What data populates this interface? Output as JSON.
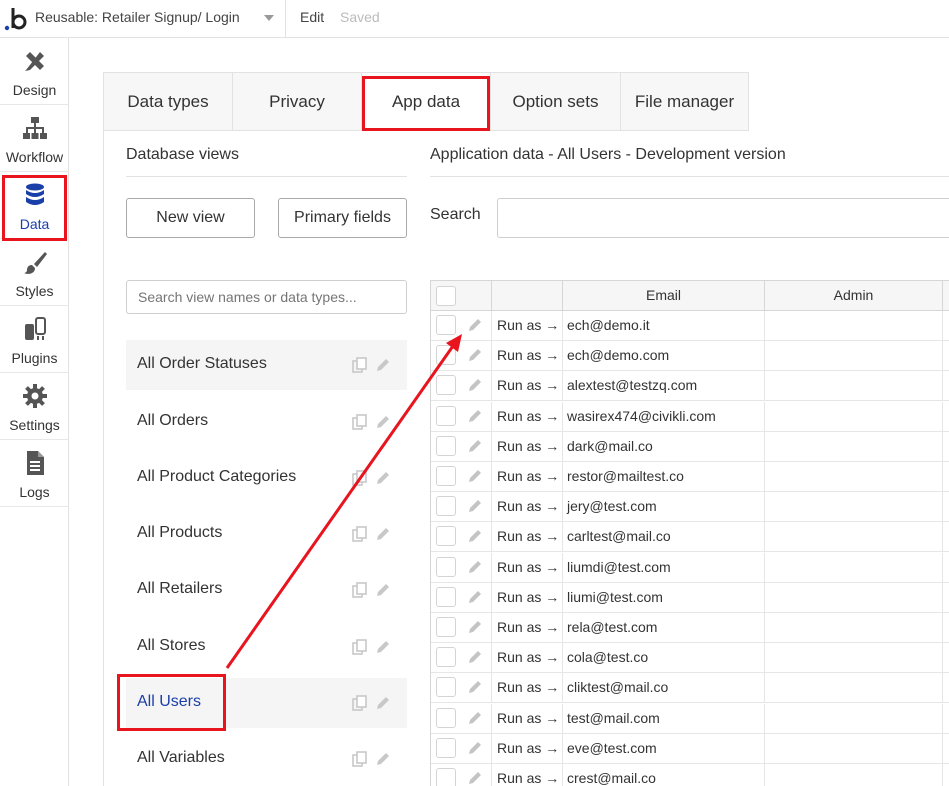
{
  "topbar": {
    "page_name": "Reusable: Retailer Signup/ Login",
    "edit_label": "Edit",
    "saved_label": "Saved"
  },
  "sidebar": {
    "items": [
      {
        "label": "Design",
        "icon": "design-icon"
      },
      {
        "label": "Workflow",
        "icon": "workflow-icon"
      },
      {
        "label": "Data",
        "icon": "database-icon",
        "active": true
      },
      {
        "label": "Styles",
        "icon": "brush-icon"
      },
      {
        "label": "Plugins",
        "icon": "plugin-icon"
      },
      {
        "label": "Settings",
        "icon": "gear-icon"
      },
      {
        "label": "Logs",
        "icon": "document-icon"
      }
    ]
  },
  "tabs": [
    {
      "label": "Data types"
    },
    {
      "label": "Privacy"
    },
    {
      "label": "App data",
      "active": true
    },
    {
      "label": "Option sets"
    },
    {
      "label": "File manager"
    }
  ],
  "database_views": {
    "title": "Database views",
    "new_view_label": "New view",
    "primary_fields_label": "Primary fields",
    "search_placeholder": "Search view names or data types...",
    "views": [
      {
        "label": "All Order Statuses"
      },
      {
        "label": "All Orders"
      },
      {
        "label": "All Product Categories"
      },
      {
        "label": "All Products"
      },
      {
        "label": "All Retailers"
      },
      {
        "label": "All Stores"
      },
      {
        "label": "All Users",
        "selected": true
      },
      {
        "label": "All Variables"
      }
    ]
  },
  "app_data": {
    "title": "Application data - All Users - Development version",
    "search_label": "Search",
    "columns": [
      "Email",
      "Admin"
    ],
    "run_as_label": "Run as →",
    "rows": [
      {
        "email": "ech@demo.it"
      },
      {
        "email": "ech@demo.com"
      },
      {
        "email": "alextest@testzq.com"
      },
      {
        "email": "wasirex474@civikli.com"
      },
      {
        "email": "dark@mail.co"
      },
      {
        "email": "restor@mailtest.co"
      },
      {
        "email": "jery@test.com"
      },
      {
        "email": "carltest@mail.co"
      },
      {
        "email": "liumdi@test.com"
      },
      {
        "email": "liumi@test.com"
      },
      {
        "email": "rela@test.com"
      },
      {
        "email": "cola@test.co"
      },
      {
        "email": "cliktest@mail.co"
      },
      {
        "email": "test@mail.com"
      },
      {
        "email": "eve@test.com"
      },
      {
        "email": "crest@mail.co"
      }
    ]
  },
  "colors": {
    "highlight": "#e8141e",
    "accent_blue": "#1a3fa8"
  }
}
